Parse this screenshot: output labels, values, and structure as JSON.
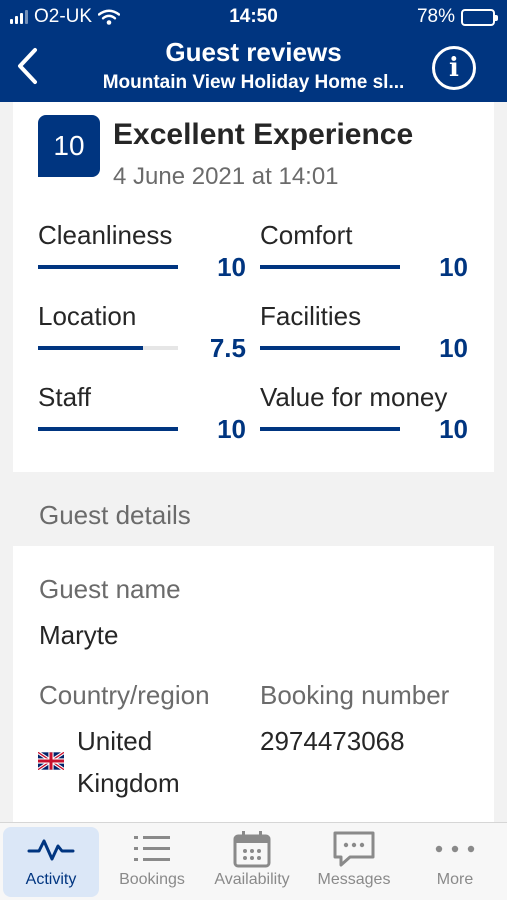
{
  "status_bar": {
    "carrier": "O2-UK",
    "time": "14:50",
    "battery": "78%",
    "battery_level": 0.78
  },
  "header": {
    "title": "Guest reviews",
    "subtitle": "Mountain View Holiday Home sl..."
  },
  "review": {
    "score": "10",
    "headline": "Excellent Experience",
    "date": "4 June 2021 at 14:01",
    "metrics": [
      {
        "label": "Cleanliness",
        "value": "10",
        "level": 1.0
      },
      {
        "label": "Comfort",
        "value": "10",
        "level": 1.0
      },
      {
        "label": "Location",
        "value": "7.5",
        "level": 0.75
      },
      {
        "label": "Facilities",
        "value": "10",
        "level": 1.0
      },
      {
        "label": "Staff",
        "value": "10",
        "level": 1.0
      },
      {
        "label": "Value for money",
        "value": "10",
        "level": 1.0
      }
    ]
  },
  "guest_details": {
    "section_title": "Guest details",
    "name_label": "Guest name",
    "name": "Maryte",
    "country_label": "Country/region",
    "country_line1": "United",
    "country_line2": "Kingdom",
    "booking_label": "Booking number",
    "booking_number": "2974473068"
  },
  "tabs": [
    {
      "label": "Activity",
      "icon": "activity-icon",
      "active": true
    },
    {
      "label": "Bookings",
      "icon": "list-icon",
      "active": false
    },
    {
      "label": "Availability",
      "icon": "calendar-icon",
      "active": false
    },
    {
      "label": "Messages",
      "icon": "chat-icon",
      "active": false
    },
    {
      "label": "More",
      "icon": "more-icon",
      "active": false
    }
  ],
  "colors": {
    "brand": "#003580",
    "active_tab_bg": "#dbe7f7",
    "muted_text": "#6b6b6b"
  }
}
